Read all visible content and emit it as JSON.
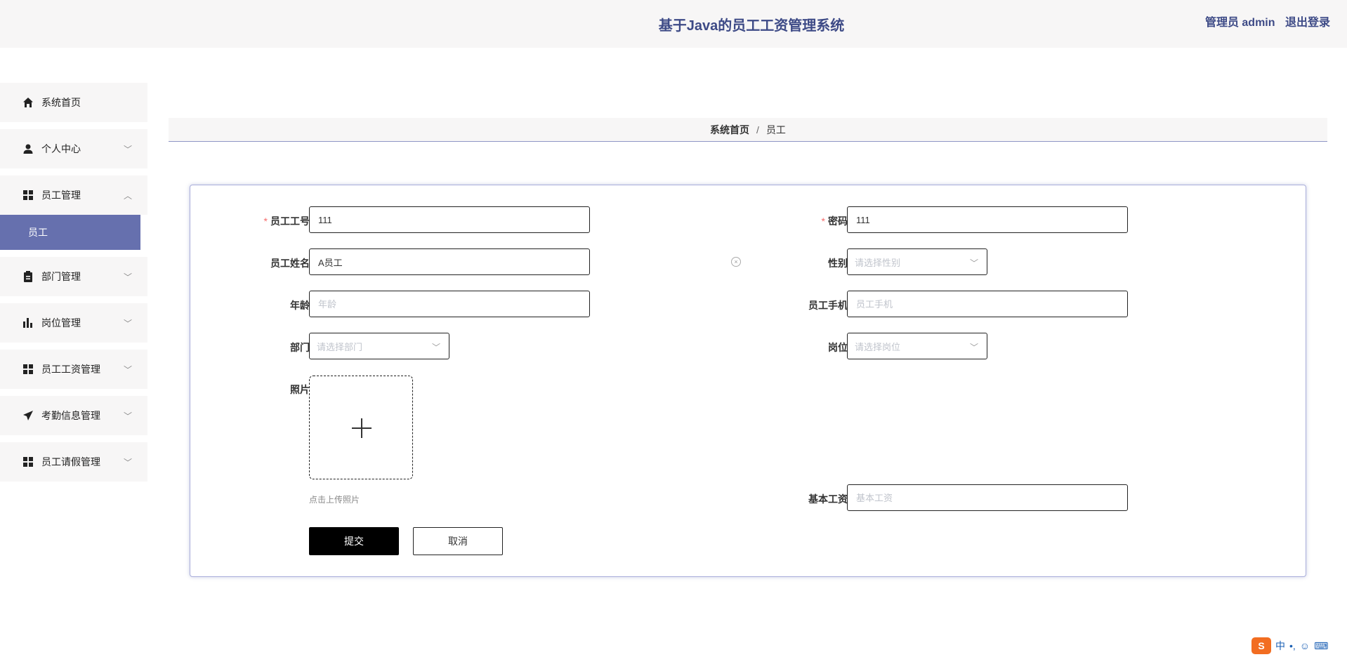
{
  "header": {
    "title": "基于Java的员工工资管理系统",
    "user": "管理员 admin",
    "logout": "退出登录"
  },
  "sidebar": {
    "items": [
      {
        "label": "系统首页",
        "icon": "home-icon"
      },
      {
        "label": "个人中心",
        "icon": "user-icon"
      },
      {
        "label": "员工管理",
        "icon": "grid-icon",
        "expanded": true,
        "children": [
          {
            "label": "员工"
          }
        ]
      },
      {
        "label": "部门管理",
        "icon": "clipboard-icon"
      },
      {
        "label": "岗位管理",
        "icon": "bar-chart-icon"
      },
      {
        "label": "员工工资管理",
        "icon": "grid-icon"
      },
      {
        "label": "考勤信息管理",
        "icon": "send-icon"
      },
      {
        "label": "员工请假管理",
        "icon": "grid-icon"
      }
    ]
  },
  "breadcrumb": {
    "home": "系统首页",
    "separator": "/",
    "current": "员工"
  },
  "form": {
    "employee_no": {
      "label": "员工工号",
      "value": "111",
      "required": true
    },
    "password": {
      "label": "密码",
      "value": "111",
      "required": true
    },
    "employee_name": {
      "label": "员工姓名",
      "value": "A员工"
    },
    "gender": {
      "label": "性别",
      "placeholder": "请选择性别"
    },
    "age": {
      "label": "年龄",
      "placeholder": "年龄"
    },
    "phone": {
      "label": "员工手机",
      "placeholder": "员工手机"
    },
    "department": {
      "label": "部门",
      "placeholder": "请选择部门"
    },
    "position": {
      "label": "岗位",
      "placeholder": "请选择岗位"
    },
    "photo": {
      "label": "照片",
      "tip": "点击上传照片"
    },
    "base_salary": {
      "label": "基本工资",
      "placeholder": "基本工资"
    },
    "submit": "提交",
    "cancel": "取消"
  },
  "ime": {
    "label": "中"
  },
  "colors": {
    "accent": "#6670ae",
    "title": "#3d4a86",
    "required": "#f56c6c"
  }
}
